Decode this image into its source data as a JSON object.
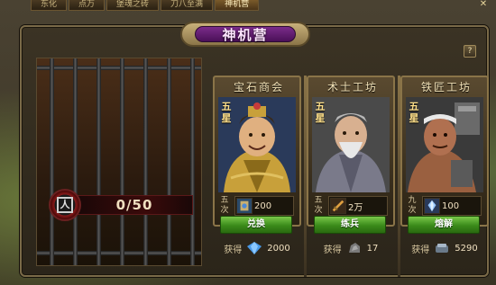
{
  "top_tabs": [
    "东化",
    "点万",
    "堡魂之砖",
    "刀八至满",
    "神机营"
  ],
  "top_close": "✕",
  "title": "神机营",
  "help": "?",
  "prison": {
    "icon": "人",
    "count": "0/50"
  },
  "cards": [
    {
      "name": "宝石商会",
      "tier": "五星",
      "stock_label": "五次",
      "stock_icon": "gem-scroll-icon",
      "stock_value": "200",
      "button": "兑换",
      "yield_label": "获得",
      "yield_icon": "blue-gem-icon",
      "yield_value": "2000",
      "colors": {
        "robe": "#c8a03a",
        "skin": "#e0b080"
      }
    },
    {
      "name": "术士工坊",
      "tier": "五星",
      "stock_label": "五次",
      "stock_icon": "sword-icon",
      "stock_value": "2万",
      "button": "练兵",
      "yield_label": "获得",
      "yield_icon": "ore-icon",
      "yield_value": "17",
      "colors": {
        "robe": "#6a6a7a",
        "skin": "#d8b090"
      }
    },
    {
      "name": "铁匠工坊",
      "tier": "五星",
      "stock_label": "九次",
      "stock_icon": "crystal-icon",
      "stock_value": "100",
      "button": "熔解",
      "yield_label": "获得",
      "yield_icon": "iron-icon",
      "yield_value": "5290",
      "colors": {
        "robe": "#5a3a2a",
        "skin": "#b07050"
      }
    }
  ]
}
